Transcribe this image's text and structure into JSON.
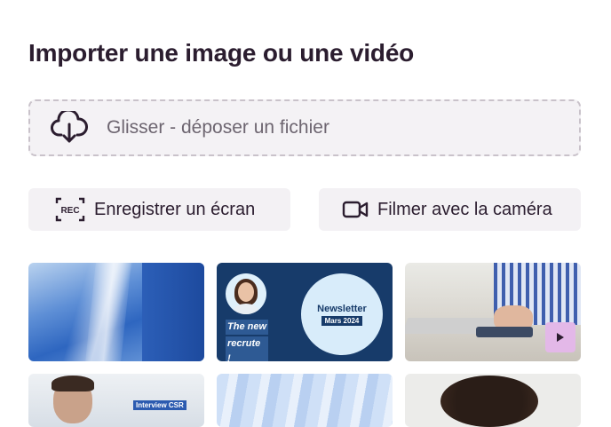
{
  "title": "Importer une image ou une vidéo",
  "dropzone": {
    "label": "Glisser - déposer un fichier",
    "icon": "cloud-download-icon"
  },
  "buttons": {
    "record_screen": {
      "label": "Enregistrer un écran",
      "icon": "rec-icon"
    },
    "camera": {
      "label": "Filmer avec la caméra",
      "icon": "video-camera-icon"
    }
  },
  "thumbnails": {
    "newsletter": {
      "tag_line1": "The new",
      "tag_line2": "recrute !",
      "title": "Newsletter",
      "subtitle": "Mars 2024"
    },
    "interview": {
      "label": "Interview CSR"
    },
    "video_icon": "play-icon"
  },
  "colors": {
    "dropzone_bg": "#f4f2f5",
    "button_bg": "#f3f1f4",
    "text": "#2b1d2f",
    "play_badge": "#e3b8e8",
    "newsletter_bg": "#173b6a"
  }
}
